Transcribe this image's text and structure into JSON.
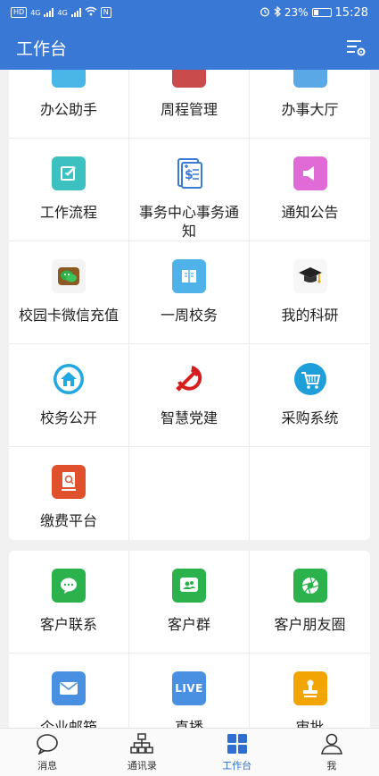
{
  "status_bar": {
    "hd_label": "HD",
    "net_1": "4G",
    "net_2": "4G",
    "nfc_label": "N",
    "battery_percent": "23%",
    "time": "15:28"
  },
  "app_bar": {
    "title": "工作台"
  },
  "section1": {
    "items": [
      {
        "label": "办公助手",
        "icon": "office-assistant-icon",
        "color": "#49b6e8"
      },
      {
        "label": "周程管理",
        "icon": "schedule-icon",
        "color": "#c94b4b"
      },
      {
        "label": "办事大厅",
        "icon": "service-hall-icon",
        "color": "#5aa9e6"
      },
      {
        "label": "工作流程",
        "icon": "workflow-edit-icon",
        "color": "#3cc0c0"
      },
      {
        "label": "事务中心事务通知",
        "icon": "notice-doc-icon",
        "color": "#3a7bd5"
      },
      {
        "label": "通知公告",
        "icon": "megaphone-icon",
        "color": "#e06ad6"
      },
      {
        "label": "校园卡微信充值",
        "icon": "wechat-icon",
        "color": "#2eae4a"
      },
      {
        "label": "一周校务",
        "icon": "book-icon",
        "color": "#4fb3ea"
      },
      {
        "label": "我的科研",
        "icon": "graduation-cap-icon",
        "color": "#333333"
      },
      {
        "label": "校务公开",
        "icon": "home-icon",
        "color": "#23a7e0"
      },
      {
        "label": "智慧党建",
        "icon": "party-emblem-icon",
        "color": "#d71e1e"
      },
      {
        "label": "采购系统",
        "icon": "cart-icon",
        "color": "#1e9fd9"
      },
      {
        "label": "缴费平台",
        "icon": "payment-icon",
        "color": "#e0502d"
      }
    ]
  },
  "section2": {
    "items": [
      {
        "label": "客户联系",
        "icon": "chat-bubble-icon",
        "color": "#2bb24c"
      },
      {
        "label": "客户群",
        "icon": "customer-group-icon",
        "color": "#2bb24c"
      },
      {
        "label": "客户朋友圈",
        "icon": "moments-icon",
        "color": "#2bb24c"
      },
      {
        "label": "企业邮箱",
        "icon": "mail-icon",
        "color": "#4a90e2"
      },
      {
        "label": "直播",
        "icon": "live-icon",
        "color": "#4a90e2",
        "badge": "LIVE"
      },
      {
        "label": "审批",
        "icon": "approval-stamp-icon",
        "color": "#f2a500"
      }
    ]
  },
  "bottom_nav": {
    "tabs": [
      {
        "label": "消息"
      },
      {
        "label": "通讯录"
      },
      {
        "label": "工作台"
      },
      {
        "label": "我"
      }
    ]
  }
}
